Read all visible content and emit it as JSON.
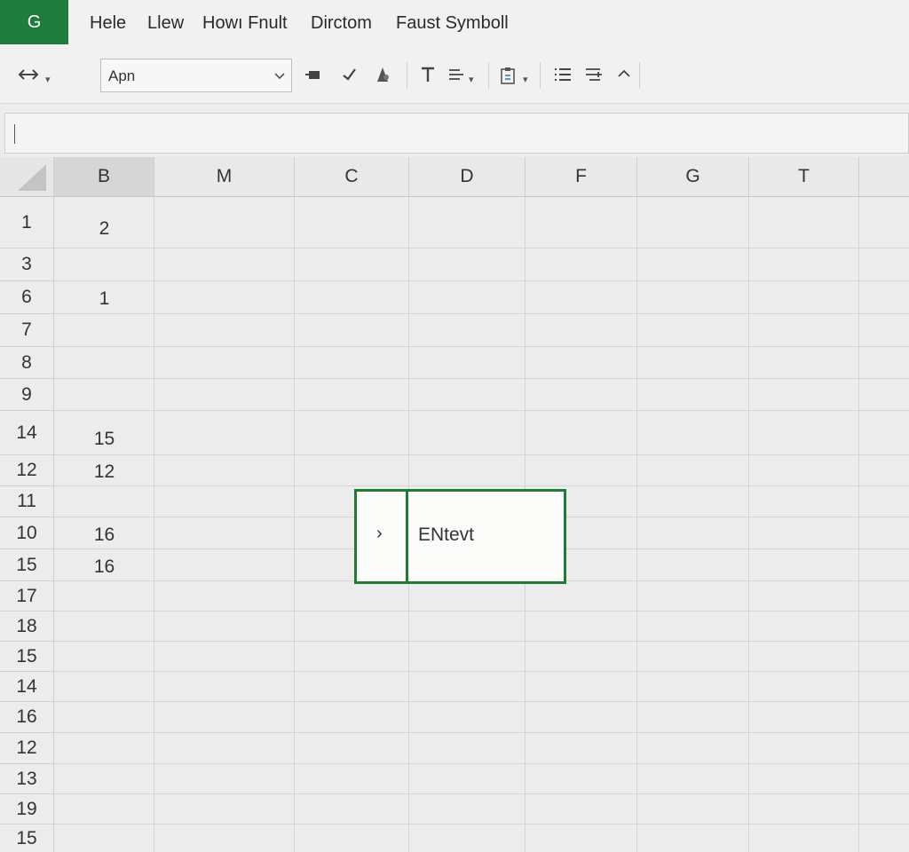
{
  "app": {
    "logo_letter": "G",
    "accent": "#1e7c3c"
  },
  "menu": [
    "Hele",
    "Llew",
    "Howı Fnult",
    "Dirctom",
    "Faust Symboll"
  ],
  "toolbar": {
    "font_value": "Apn",
    "icons": [
      "undo-redo-icon",
      "dropdown-caret-icon",
      "paint-icon",
      "check-icon",
      "person-icon",
      "text-icon",
      "align-icon",
      "clipboard-icon",
      "list-icon",
      "indent-icon",
      "chevron-up-icon"
    ]
  },
  "formula_bar": {
    "value": ""
  },
  "columns": [
    "B",
    "M",
    "C",
    "D",
    "F",
    "G",
    "T"
  ],
  "rows": [
    {
      "num": "1",
      "b": "2"
    },
    {
      "num": "3",
      "b": ""
    },
    {
      "num": "6",
      "b": "1"
    },
    {
      "num": "7",
      "b": ""
    },
    {
      "num": "8",
      "b": ""
    },
    {
      "num": "9",
      "b": ""
    },
    {
      "num": "14",
      "b": "15"
    },
    {
      "num": "12",
      "b": "12"
    },
    {
      "num": "11",
      "b": ""
    },
    {
      "num": "10",
      "b": "16"
    },
    {
      "num": "15",
      "b": "16"
    },
    {
      "num": "17",
      "b": ""
    },
    {
      "num": "18",
      "b": ""
    },
    {
      "num": "15",
      "b": ""
    },
    {
      "num": "14",
      "b": ""
    },
    {
      "num": "16",
      "b": ""
    },
    {
      "num": "12",
      "b": ""
    },
    {
      "num": "13",
      "b": ""
    },
    {
      "num": "19",
      "b": ""
    },
    {
      "num": "15",
      "b": ""
    }
  ],
  "popup": {
    "arrow": "›",
    "text": "ENtevt"
  }
}
